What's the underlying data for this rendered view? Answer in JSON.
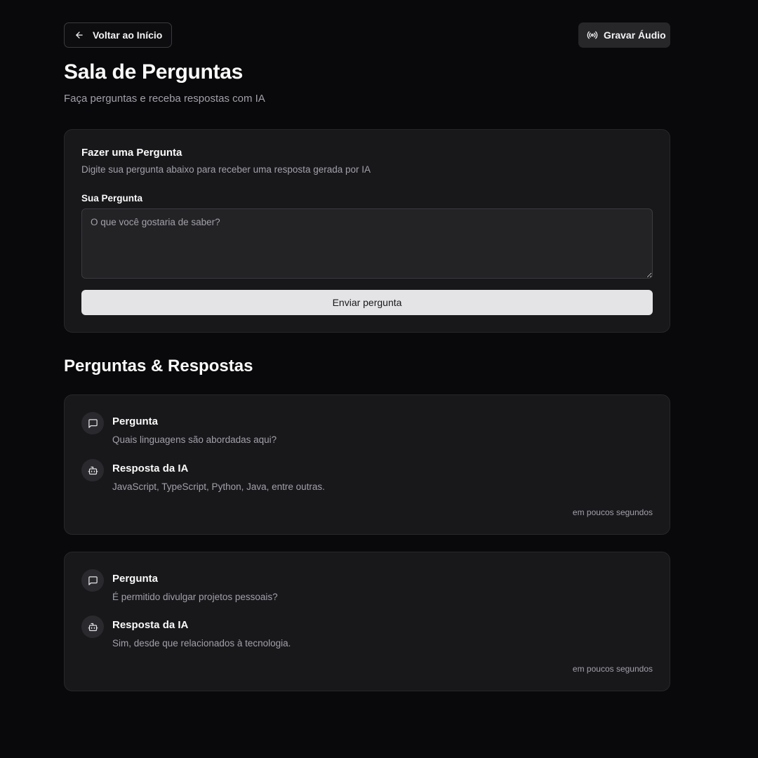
{
  "header": {
    "back_label": "Voltar ao Início",
    "audio_label": "Gravar Áudio"
  },
  "page": {
    "title": "Sala de Perguntas",
    "subtitle": "Faça perguntas e receba respostas com IA"
  },
  "form": {
    "title": "Fazer uma Pergunta",
    "description": "Digite sua pergunta abaixo para receber uma resposta gerada por IA",
    "field_label": "Sua Pergunta",
    "placeholder": "O que você gostaria de saber?",
    "value": "",
    "submit_label": "Enviar pergunta"
  },
  "qa_section": {
    "title": "Perguntas & Respostas",
    "items": [
      {
        "question_heading": "Pergunta",
        "question": "Quais linguagens são abordadas aqui?",
        "answer_heading": "Resposta da IA",
        "answer": "JavaScript, TypeScript, Python, Java, entre outras.",
        "time": "em poucos segundos"
      },
      {
        "question_heading": "Pergunta",
        "question": "É permitido divulgar projetos pessoais?",
        "answer_heading": "Resposta da IA",
        "answer": "Sim, desde que relacionados à tecnologia.",
        "time": "em poucos segundos"
      }
    ]
  },
  "colors": {
    "background": "#09090b",
    "card": "#18181b",
    "muted_text": "#a1a1aa",
    "primary_button": "#e4e4e7"
  },
  "icons": {
    "back": "arrow-left-icon",
    "audio": "radio-icon",
    "question": "message-square-icon",
    "answer": "bot-icon"
  }
}
